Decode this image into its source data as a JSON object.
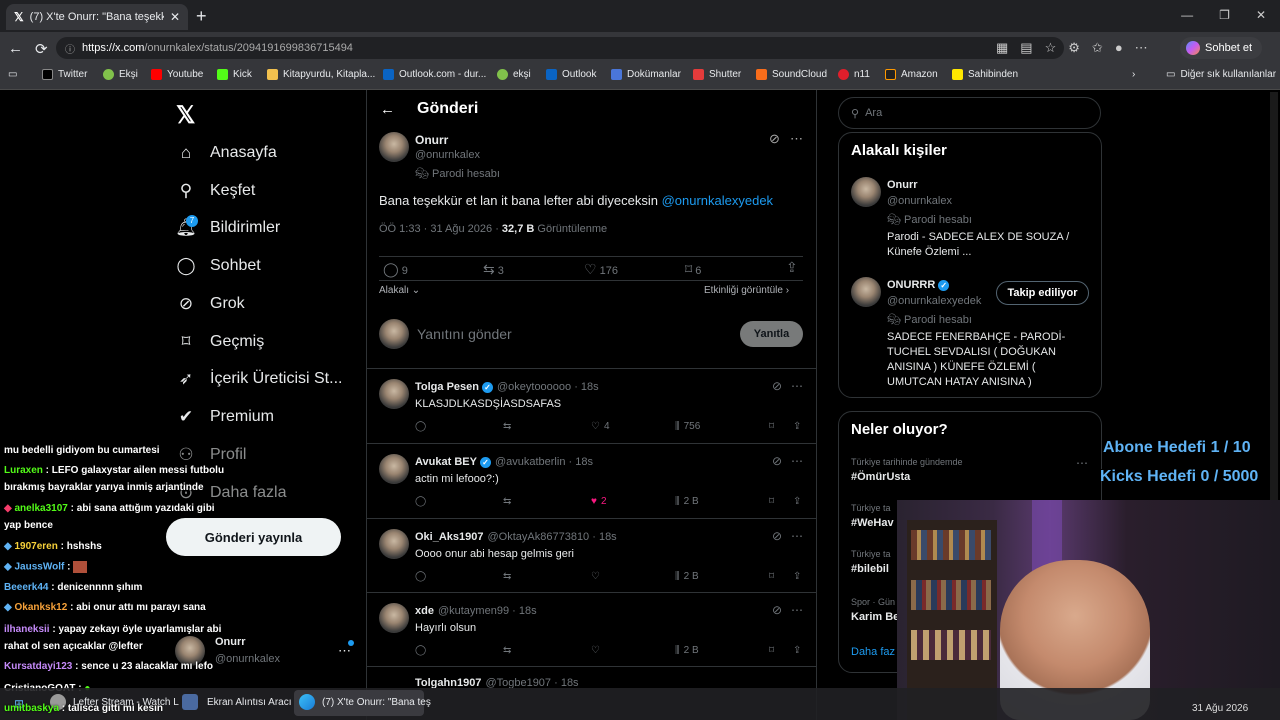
{
  "browser": {
    "tab_title": "(7) X'te Onurr: \"Bana teşekkür et la",
    "url_host": "https://x.com",
    "url_path": "/onurnkalex/status/2094191699836715494",
    "sohbet_label": "Sohbet et",
    "bookmarks": [
      "Twitter",
      "Ekşi",
      "Youtube",
      "Kick",
      "Kitapyurdu, Kitapla...",
      "Outlook.com - dur...",
      "ekşi",
      "Outlook",
      "Dokümanlar",
      "Shutter",
      "SoundCloud",
      "n11",
      "Amazon",
      "Sahibinden"
    ],
    "other_bookmarks": "Diğer sık kullanılanlar"
  },
  "sidebar": {
    "items": [
      "Anasayfa",
      "Keşfet",
      "Bildirimler",
      "Sohbet",
      "Grok",
      "Geçmiş",
      "İçerik Üreticisi St...",
      "Premium",
      "Profil",
      "Daha fazla"
    ],
    "notif_badge": "7",
    "post_button": "Gönderi yayınla",
    "account_name": "Onurr",
    "account_handle": "@onurnkalex"
  },
  "main": {
    "header": "Gönderi",
    "post": {
      "name": "Onurr",
      "handle": "@onurnkalex",
      "parody": "Parodi hesabı",
      "text": "Bana teşekkür et lan it bana lefter abi diyeceksin",
      "mention": "@onurnkalexyedek",
      "time": "ÖÖ 1:33 · 31 Ağu 2026 ·",
      "views": "32,7 B",
      "views_label": "Görüntülenme",
      "replies": "9",
      "reposts": "3",
      "likes": "176",
      "bookmarks": "6",
      "relevance": "Alakalı",
      "activity": "Etkinliği görüntüle"
    },
    "reply_box": {
      "placeholder": "Yanıtını gönder",
      "button": "Yanıtla"
    },
    "replies": [
      {
        "name": "Tolga Pesen",
        "handle": "@okeytoooooo · 18s",
        "text": "KLASJDLKASDŞİASDSAFAS",
        "likes": "4",
        "views": "756"
      },
      {
        "name": "Avukat BEY",
        "handle": "@avukatberlin · 18s",
        "text": "actin mi lefooo?:)",
        "likes": "2",
        "views": "2 B"
      },
      {
        "name": "Oki_Aks1907",
        "handle": "@OktayAk86773810 · 18s",
        "text": "Oooo onur abi hesap gelmis geri",
        "likes": "",
        "views": "2 B"
      },
      {
        "name": "xde",
        "handle": "@kutaymen99 · 18s",
        "text": "Hayırlı olsun",
        "likes": "",
        "views": "2 B"
      },
      {
        "name": "Tolgahn1907",
        "handle": "@Togbe1907 · 18s",
        "text": "",
        "likes": "",
        "views": ""
      }
    ]
  },
  "right": {
    "search_placeholder": "Ara",
    "related_title": "Alakalı kişiler",
    "people": [
      {
        "name": "Onurr",
        "handle": "@onurnkalex",
        "parody": "Parodi hesabı",
        "bio": "Parodi - SADECE ALEX DE SOUZA / Künefe Özlemi ..."
      },
      {
        "name": "ONURRR",
        "handle": "@onurnkalexyedek",
        "parody": "Parodi hesabı",
        "bio": "SADECE FENERBAHÇE - PARODİ- TUCHEL SEVDALISI ( DOĞUKAN ANISINA ) KÜNEFE ÖZLEMİ ( UMUTCAN HATAY ANISINA )",
        "button": "Takip ediliyor"
      }
    ],
    "whats_title": "Neler oluyor?",
    "trends": [
      {
        "cat": "Türkiye tarihinde gündemde",
        "name": "#ÖmürUsta"
      },
      {
        "cat": "Türkiye ta",
        "name": "#WeHav"
      },
      {
        "cat": "Türkiye ta",
        "name": "#bilebil"
      },
      {
        "cat": "Spor · Gün",
        "name": "Karim Be"
      }
    ],
    "more": "Daha faz"
  },
  "overlay": {
    "goal1": "Abone Hedefi 1 / 10",
    "goal2": "Kicks Hedefi 0 / 5000",
    "chat": [
      {
        "user": "",
        "msg": "mu bedelli gidiyom bu cumartesi",
        "color": "#ffffff"
      },
      {
        "user": "Luraxen",
        "msg": " : LEFO galaxystar ailen messi futbolu",
        "color": "#53fc18"
      },
      {
        "user": "",
        "msg": "bırakmış bayraklar yarıya inmiş arjantinde",
        "color": "#ffffff"
      },
      {
        "user": "anelka3107",
        "msg": " : abi sana attığım yazıdaki gibi",
        "color": "#53fc18"
      },
      {
        "user": "",
        "msg": "yap bence",
        "color": "#ffffff"
      },
      {
        "user": "1907eren",
        "msg": " : hshshs",
        "color": "#f7d13a"
      },
      {
        "user": "JaussWolf",
        "msg": " :",
        "color": "#5fb3f5"
      },
      {
        "user": "Beeerk44",
        "msg": " : denicennnn şıhım",
        "color": "#5fb3f5"
      },
      {
        "user": "Okanksk12",
        "msg": " : abi onur attı mı parayı sana",
        "color": "#f7a23a"
      },
      {
        "user": "ilhaneksii",
        "msg": " : yapay zekayı öyle uyarlamışlar abi",
        "color": "#c58af9"
      },
      {
        "user": "",
        "msg": "rahat ol sen açıcaklar @lefter",
        "color": "#ffffff"
      },
      {
        "user": "Kursatdayi123",
        "msg": " : sence u 23 alacaklar mı lefo",
        "color": "#c58af9"
      },
      {
        "user": "CristianoGOAT",
        "msg": " :",
        "color": "#ffffff"
      },
      {
        "user": "umitbaskya",
        "msg": " : talisca gitti mi kesin",
        "color": "#53fc18"
      }
    ]
  },
  "taskbar": {
    "items": [
      "Lefter Stream - Watch L",
      "Ekran Alıntısı Aracı",
      "(7) X'te Onurr: \"Bana teş"
    ],
    "date": "31 Ağu 2026"
  }
}
